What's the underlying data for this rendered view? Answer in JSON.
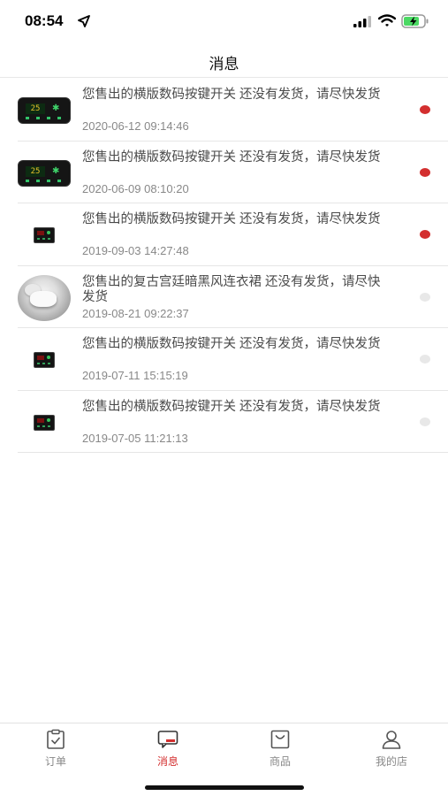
{
  "status": {
    "time": "08:54",
    "icons": [
      "location-arrow-icon",
      "cellular-signal-icon",
      "wifi-icon",
      "battery-charging-icon"
    ],
    "battery_color": "#4cd964"
  },
  "nav": {
    "title": "消息"
  },
  "colors": {
    "unread": "#d32f2f",
    "read": "#e8e8e8",
    "active_tab": "#d32f2f"
  },
  "messages": [
    {
      "thumb": "switch-large",
      "text": "您售出的横版数码按键开关 还没有发货，请尽快发货",
      "date": "2020-06-12 09:14:46",
      "unread": true
    },
    {
      "thumb": "switch-large",
      "text": "您售出的横版数码按键开关 还没有发货，请尽快发货",
      "date": "2020-06-09 08:10:20",
      "unread": true
    },
    {
      "thumb": "switch-small",
      "text": "您售出的横版数码按键开关 还没有发货，请尽快发货",
      "date": "2019-09-03 14:27:48",
      "unread": true
    },
    {
      "thumb": "dress-photo",
      "text": "您售出的复古宫廷暗黑风连衣裙 还没有发货，请尽快发货",
      "date": "2019-08-21 09:22:37",
      "unread": false
    },
    {
      "thumb": "switch-small",
      "text": "您售出的横版数码按键开关 还没有发货，请尽快发货",
      "date": "2019-07-11 15:15:19",
      "unread": false
    },
    {
      "thumb": "switch-small",
      "text": "您售出的横版数码按键开关 还没有发货，请尽快发货",
      "date": "2019-07-05 11:21:13",
      "unread": false
    }
  ],
  "tabs": [
    {
      "label": "订单",
      "icon": "order-clipboard-icon",
      "active": false
    },
    {
      "label": "消息",
      "icon": "message-bubble-icon",
      "active": true
    },
    {
      "label": "商品",
      "icon": "goods-bag-icon",
      "active": false
    },
    {
      "label": "我的店",
      "icon": "profile-user-icon",
      "active": false
    }
  ]
}
